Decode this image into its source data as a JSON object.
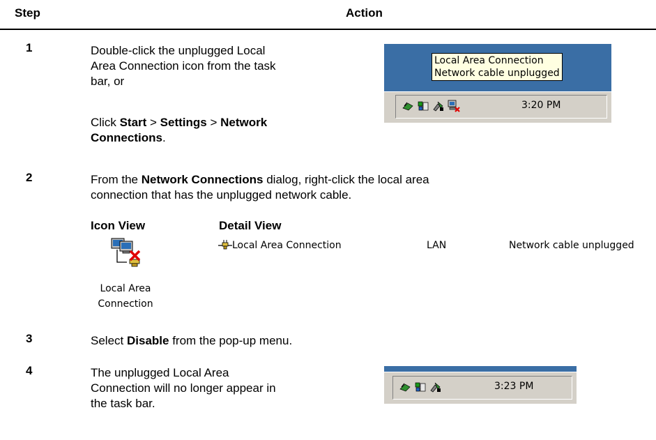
{
  "header": {
    "step": "Step",
    "action": "Action"
  },
  "steps": [
    {
      "num": "1",
      "line1": "Double-click the unplugged Local",
      "line2": "Area Connection icon from the task",
      "line3": "bar, or",
      "alt_prefix": "Click ",
      "alt_start": "Start",
      "alt_sep1": " > ",
      "alt_settings": "Settings",
      "alt_sep2": " > ",
      "alt_network": "Network",
      "alt_connections": "Connections",
      "alt_end": "."
    },
    {
      "num": "2",
      "pre": "From the ",
      "bold": "Network Connections",
      "post": " dialog, right-click the local area",
      "line2": "connection that has the unplugged network cable."
    },
    {
      "num": "3",
      "pre": "Select ",
      "bold": "Disable",
      "post": " from the pop-up menu."
    },
    {
      "num": "4",
      "line1": "The unplugged Local Area",
      "line2": "Connection will no longer appear in",
      "line3": "the task bar."
    }
  ],
  "tray1": {
    "tooltip_line1": "Local Area Connection",
    "tooltip_line2": "Network cable unplugged",
    "clock": "3:20 PM"
  },
  "views": {
    "icon_view_title": "Icon View",
    "detail_view_title": "Detail View",
    "icon_label_line1": "Local Area",
    "icon_label_line2": "Connection",
    "detail_name": "Local Area Connection",
    "detail_type": "LAN",
    "detail_status": "Network cable unplugged"
  },
  "tray2": {
    "clock": "3:23 PM"
  }
}
